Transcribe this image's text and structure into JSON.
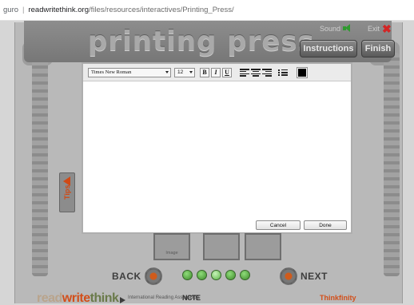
{
  "browser": {
    "security_text": "guro",
    "separator": "|",
    "domain": "readwritethink.org",
    "path": "/files/resources/interactives/Printing_Press/"
  },
  "app": {
    "title": "printing press",
    "sound_label": "Sound",
    "exit_label": "Exit",
    "instructions_label": "Instructions",
    "finish_label": "Finish",
    "tips_label": "Tips",
    "back_label": "BACK",
    "next_label": "NEXT",
    "slot_label": "Image",
    "progress_dots": 5,
    "footer": {
      "logo_read": "read",
      "logo_write": "write",
      "logo_think": "think",
      "ira": "International Reading Association",
      "ncte": "NCTE",
      "thinkfinity": "Thinkfinity"
    }
  },
  "editor_dialog": {
    "font_family": "Times New Roman",
    "font_size": "12",
    "bold_label": "B",
    "italic_label": "I",
    "underline_label": "U",
    "text_color": "#000000",
    "content": "",
    "cancel_label": "Cancel",
    "done_label": "Done"
  },
  "colors": {
    "accent": "#d24f1a",
    "status_green": "#3e8b2b",
    "exit_red": "#d32525"
  }
}
